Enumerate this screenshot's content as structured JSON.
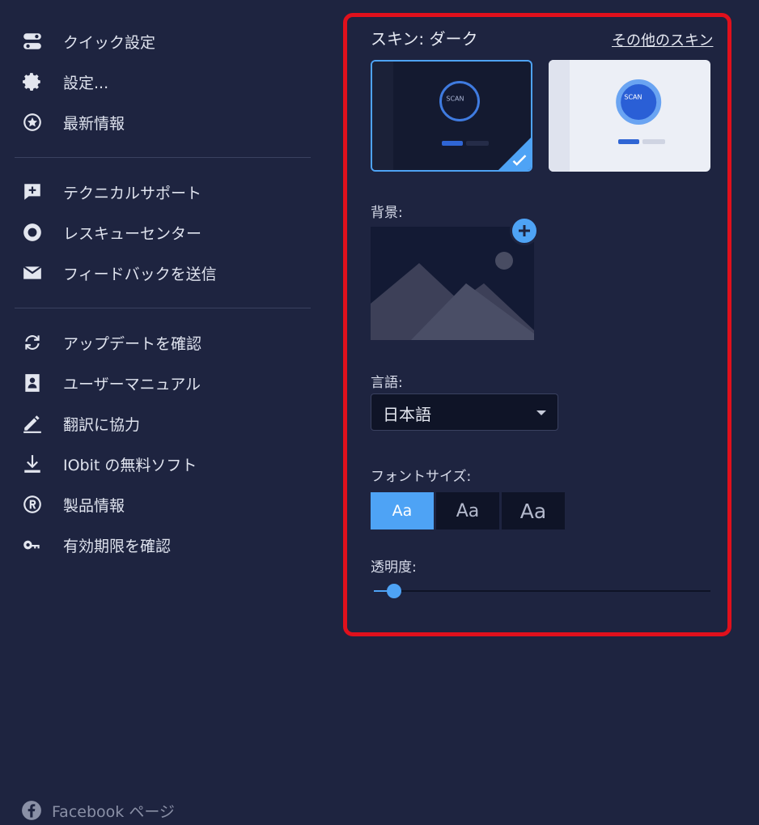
{
  "menu": {
    "group1": [
      {
        "label": "クイック設定",
        "icon": "toggle-icon"
      },
      {
        "label": "設定...",
        "icon": "gear-icon"
      },
      {
        "label": "最新情報",
        "icon": "star-badge-icon"
      }
    ],
    "group2": [
      {
        "label": "テクニカルサポート",
        "icon": "support-chat-icon"
      },
      {
        "label": "レスキューセンター",
        "icon": "lifebuoy-icon"
      },
      {
        "label": "フィードバックを送信",
        "icon": "envelope-icon"
      }
    ],
    "group3": [
      {
        "label": "アップデートを確認",
        "icon": "refresh-icon"
      },
      {
        "label": "ユーザーマニュアル",
        "icon": "manual-icon"
      },
      {
        "label": "翻訳に協力",
        "icon": "pen-icon"
      },
      {
        "label": "IObit の無料ソフト",
        "icon": "download-icon"
      },
      {
        "label": "製品情報",
        "icon": "registered-icon"
      },
      {
        "label": "有効期限を確認",
        "icon": "key-icon"
      }
    ],
    "facebook": "Facebook ページ"
  },
  "panel": {
    "skin_label": "スキン: ダーク",
    "skin_more_link": "その他のスキン",
    "skin_scan_dark": "SCAN",
    "skin_scan_light": "SCAN",
    "background_label": "背景:",
    "language_label": "言語:",
    "language_value": "日本語",
    "font_size_label": "フォントサイズ:",
    "font_sizes": [
      "Aa",
      "Aa",
      "Aa"
    ],
    "font_size_selected": 0,
    "transparency_label": "透明度:",
    "transparency_value": 0.04
  },
  "colors": {
    "accent": "#4ea3f5",
    "highlight_border": "#e0101c",
    "background": "#1e2440"
  }
}
